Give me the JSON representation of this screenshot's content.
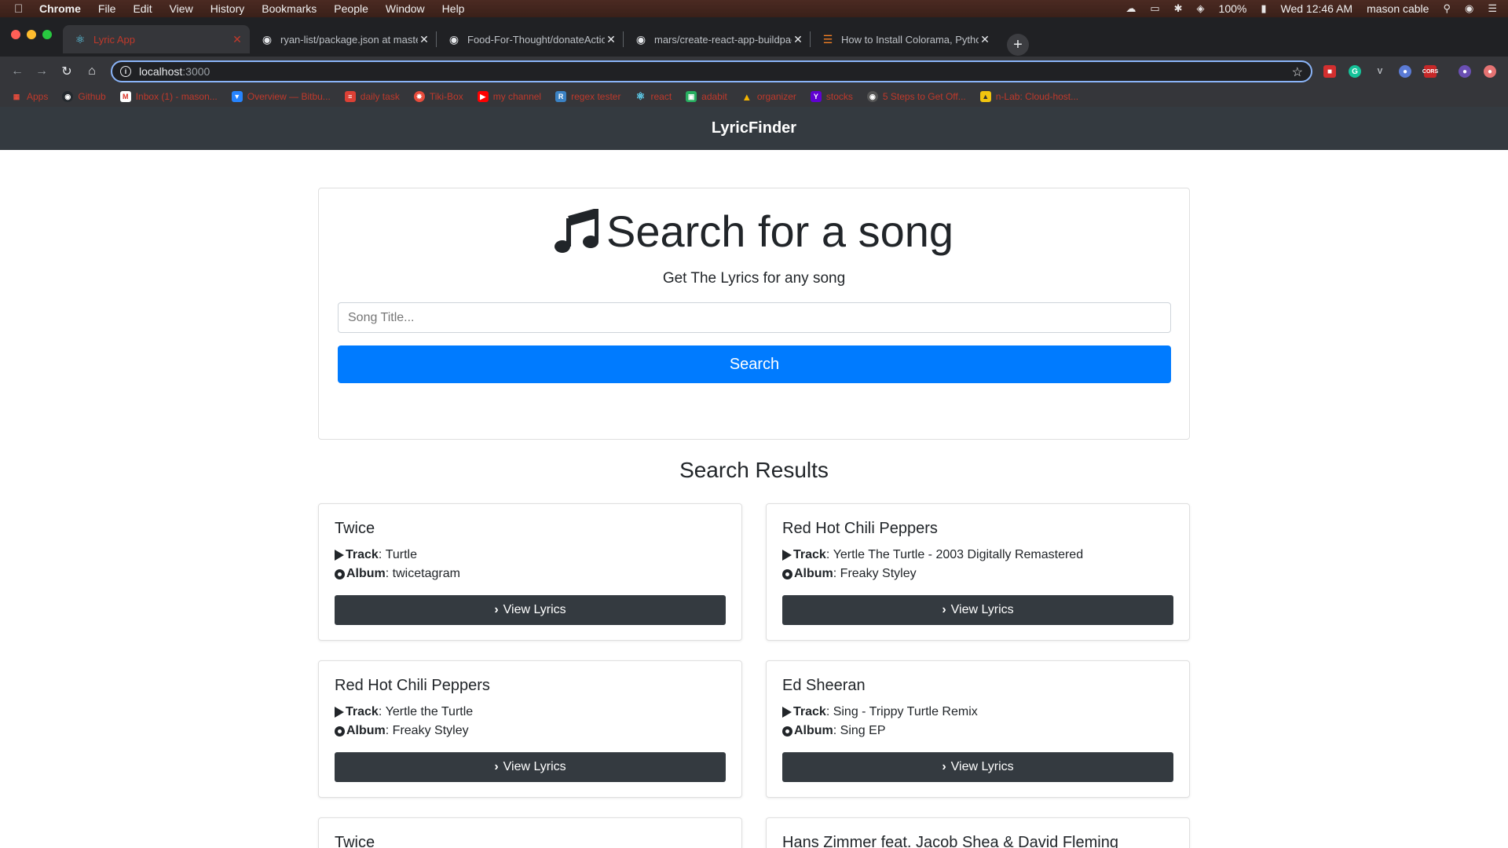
{
  "menubar": {
    "app": "Chrome",
    "items": [
      "File",
      "Edit",
      "View",
      "History",
      "Bookmarks",
      "People",
      "Window",
      "Help"
    ],
    "battery": "100%",
    "datetime": "Wed 12:46 AM",
    "user": "mason cable"
  },
  "tabs": [
    {
      "title": "Lyric App",
      "favicon": "react-icon"
    },
    {
      "title": "ryan-list/package.json at master",
      "favicon": "github-icon"
    },
    {
      "title": "Food-For-Thought/donateAction",
      "favicon": "github-icon"
    },
    {
      "title": "mars/create-react-app-buildpack",
      "favicon": "github-icon"
    },
    {
      "title": "How to Install Colorama, Python",
      "favicon": "stack-icon"
    }
  ],
  "omnibox": {
    "host": "localhost",
    "port": ":3000"
  },
  "bookmarks": [
    {
      "label": "Apps",
      "color": "#e74c3c"
    },
    {
      "label": "Github",
      "color": "#24292e"
    },
    {
      "label": "Inbox (1) - mason...",
      "color": "#d93025"
    },
    {
      "label": "Overview — Bitbu...",
      "color": "#2684ff"
    },
    {
      "label": "daily task",
      "color": "#db4035"
    },
    {
      "label": "Tiki-Box",
      "color": "#e74c3c"
    },
    {
      "label": "my channel",
      "color": "#ff0000"
    },
    {
      "label": "regex tester",
      "color": "#3b82c4"
    },
    {
      "label": "react",
      "color": "#61dafb"
    },
    {
      "label": "adabit",
      "color": "#27ae60"
    },
    {
      "label": "organizer",
      "color": "#f4b400"
    },
    {
      "label": "stocks",
      "color": "#6001d2"
    },
    {
      "label": "5 Steps to Get Off...",
      "color": "#888888"
    },
    {
      "label": "n-Lab: Cloud-host...",
      "color": "#f1c40f"
    }
  ],
  "navbar": {
    "brand": "LyricFinder"
  },
  "search": {
    "title": "Search for a song",
    "subtitle": "Get The Lyrics for any song",
    "placeholder": "Song Title...",
    "button": "Search"
  },
  "results_heading": "Search Results",
  "labels": {
    "track": "Track",
    "album": "Album",
    "view": "View Lyrics"
  },
  "results": [
    {
      "artist": "Twice",
      "track": "Turtle",
      "album": "twicetagram"
    },
    {
      "artist": "Red Hot Chili Peppers",
      "track": "Yertle The Turtle - 2003 Digitally Remastered",
      "album": "Freaky Styley"
    },
    {
      "artist": "Red Hot Chili Peppers",
      "track": "Yertle the Turtle",
      "album": "Freaky Styley"
    },
    {
      "artist": "Ed Sheeran",
      "track": "Sing - Trippy Turtle Remix",
      "album": "Sing EP"
    },
    {
      "artist": "Twice",
      "track": "",
      "album": ""
    },
    {
      "artist": "Hans Zimmer feat. Jacob Shea & David Fleming",
      "track": "",
      "album": ""
    }
  ]
}
